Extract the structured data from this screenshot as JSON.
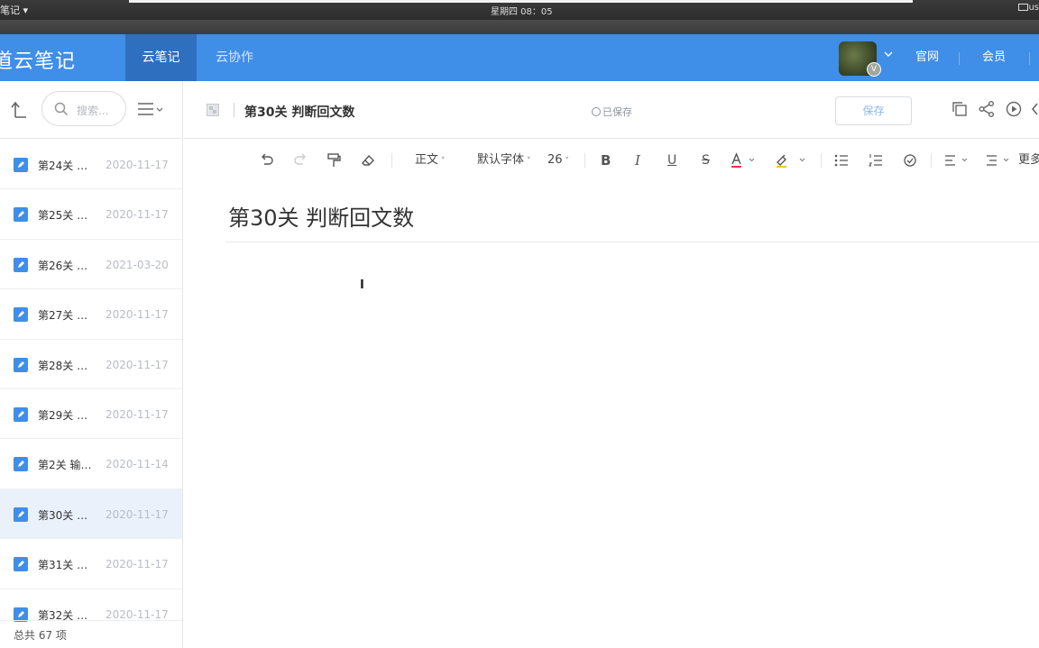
{
  "os_bar": {
    "app_menu": "笔记 ▾",
    "clock": "星期四 08：05",
    "right_label": "us"
  },
  "header": {
    "app_title": "道云笔记",
    "tabs": [
      {
        "label": "云笔记",
        "active": true
      },
      {
        "label": "云协作",
        "active": false
      }
    ],
    "avatar_badge": "V",
    "links": [
      "官网",
      "会员"
    ],
    "accent_color": "#3f8ee8"
  },
  "sidebar": {
    "search_placeholder": "搜索...",
    "notes": [
      {
        "title": "第24关 …",
        "date": "2020-11-17"
      },
      {
        "title": "第25关 …",
        "date": "2020-11-17"
      },
      {
        "title": "第26关 …",
        "date": "2021-03-20"
      },
      {
        "title": "第27关 …",
        "date": "2020-11-17"
      },
      {
        "title": "第28关 …",
        "date": "2020-11-17"
      },
      {
        "title": "第29关 …",
        "date": "2020-11-17"
      },
      {
        "title": "第2关 输…",
        "date": "2020-11-14"
      },
      {
        "title": "第30关 …",
        "date": "2020-11-17",
        "selected": true
      },
      {
        "title": "第31关 …",
        "date": "2020-11-17"
      },
      {
        "title": "第32关 …",
        "date": "2020-11-17"
      }
    ],
    "count_label": "总共 67 项"
  },
  "editor": {
    "title_top": "第30关 判断回文数",
    "save_status": "已保存",
    "save_label": "保存",
    "toolbar": {
      "paragraph_style": "正文",
      "font_family": "默认字体",
      "font_size": "26",
      "more_label": "更多"
    },
    "doc_title": "第30关 判断回文数",
    "cursor_glyph": "I"
  }
}
